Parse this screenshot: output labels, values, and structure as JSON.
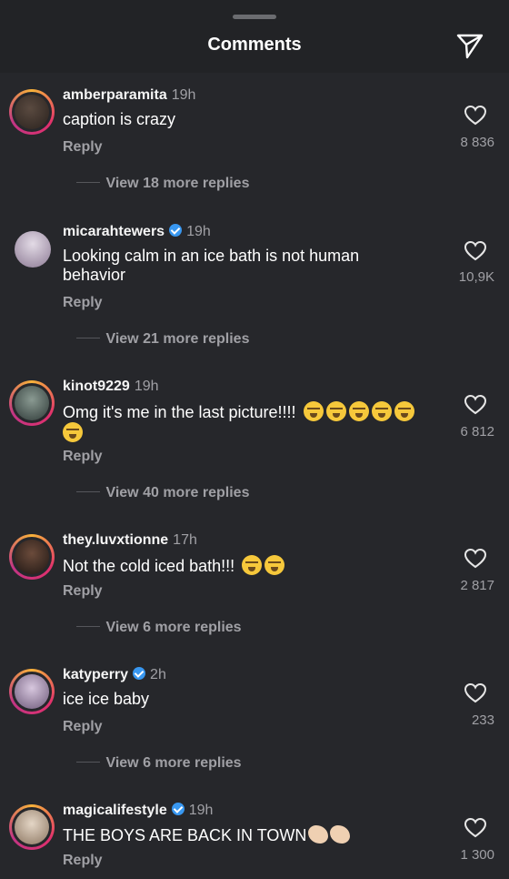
{
  "header": {
    "title": "Comments",
    "icon": "send-icon"
  },
  "comments": [
    {
      "username": "amberparamita",
      "verified": false,
      "time": "19h",
      "text": "caption is crazy",
      "emojis": "",
      "reply": "Reply",
      "likes": "8 836",
      "view_more": "View 18 more replies",
      "avatar_color": "#3a2e28"
    },
    {
      "username": "micarahtewers",
      "verified": true,
      "time": "19h",
      "text": "Looking calm in an ice bath is not human behavior",
      "emojis": "",
      "reply": "Reply",
      "likes": "10,9K",
      "view_more": "View 21 more replies",
      "avatar_color": "#c9c2cf"
    },
    {
      "username": "kinot9229",
      "verified": false,
      "time": "19h",
      "text": "Omg it's me in the last picture!!!!",
      "emojis": "loudly-crying-face x6",
      "reply": "Reply",
      "likes": "6 812",
      "view_more": "View 40 more replies",
      "avatar_color": "#4d5a56"
    },
    {
      "username": "they.luvxtionne",
      "verified": false,
      "time": "17h",
      "text": "Not the cold iced bath!!!",
      "emojis": "loudly-crying-face x2",
      "reply": "Reply",
      "likes": "2 817",
      "view_more": "View 6 more replies",
      "avatar_color": "#3b2a22"
    },
    {
      "username": "katyperry",
      "verified": true,
      "time": "2h",
      "text": "ice ice baby",
      "emojis": "",
      "reply": "Reply",
      "likes": "233",
      "view_more": "View 6 more replies",
      "avatar_color": "#b9a4c4"
    },
    {
      "username": "magicalifestyle",
      "verified": true,
      "time": "19h",
      "text": "THE BOYS ARE BACK IN TOWN",
      "emojis": "clapping-hands x2",
      "reply": "Reply",
      "likes": "1 300",
      "view_more": "",
      "avatar_color": "#cbb9a6"
    }
  ]
}
